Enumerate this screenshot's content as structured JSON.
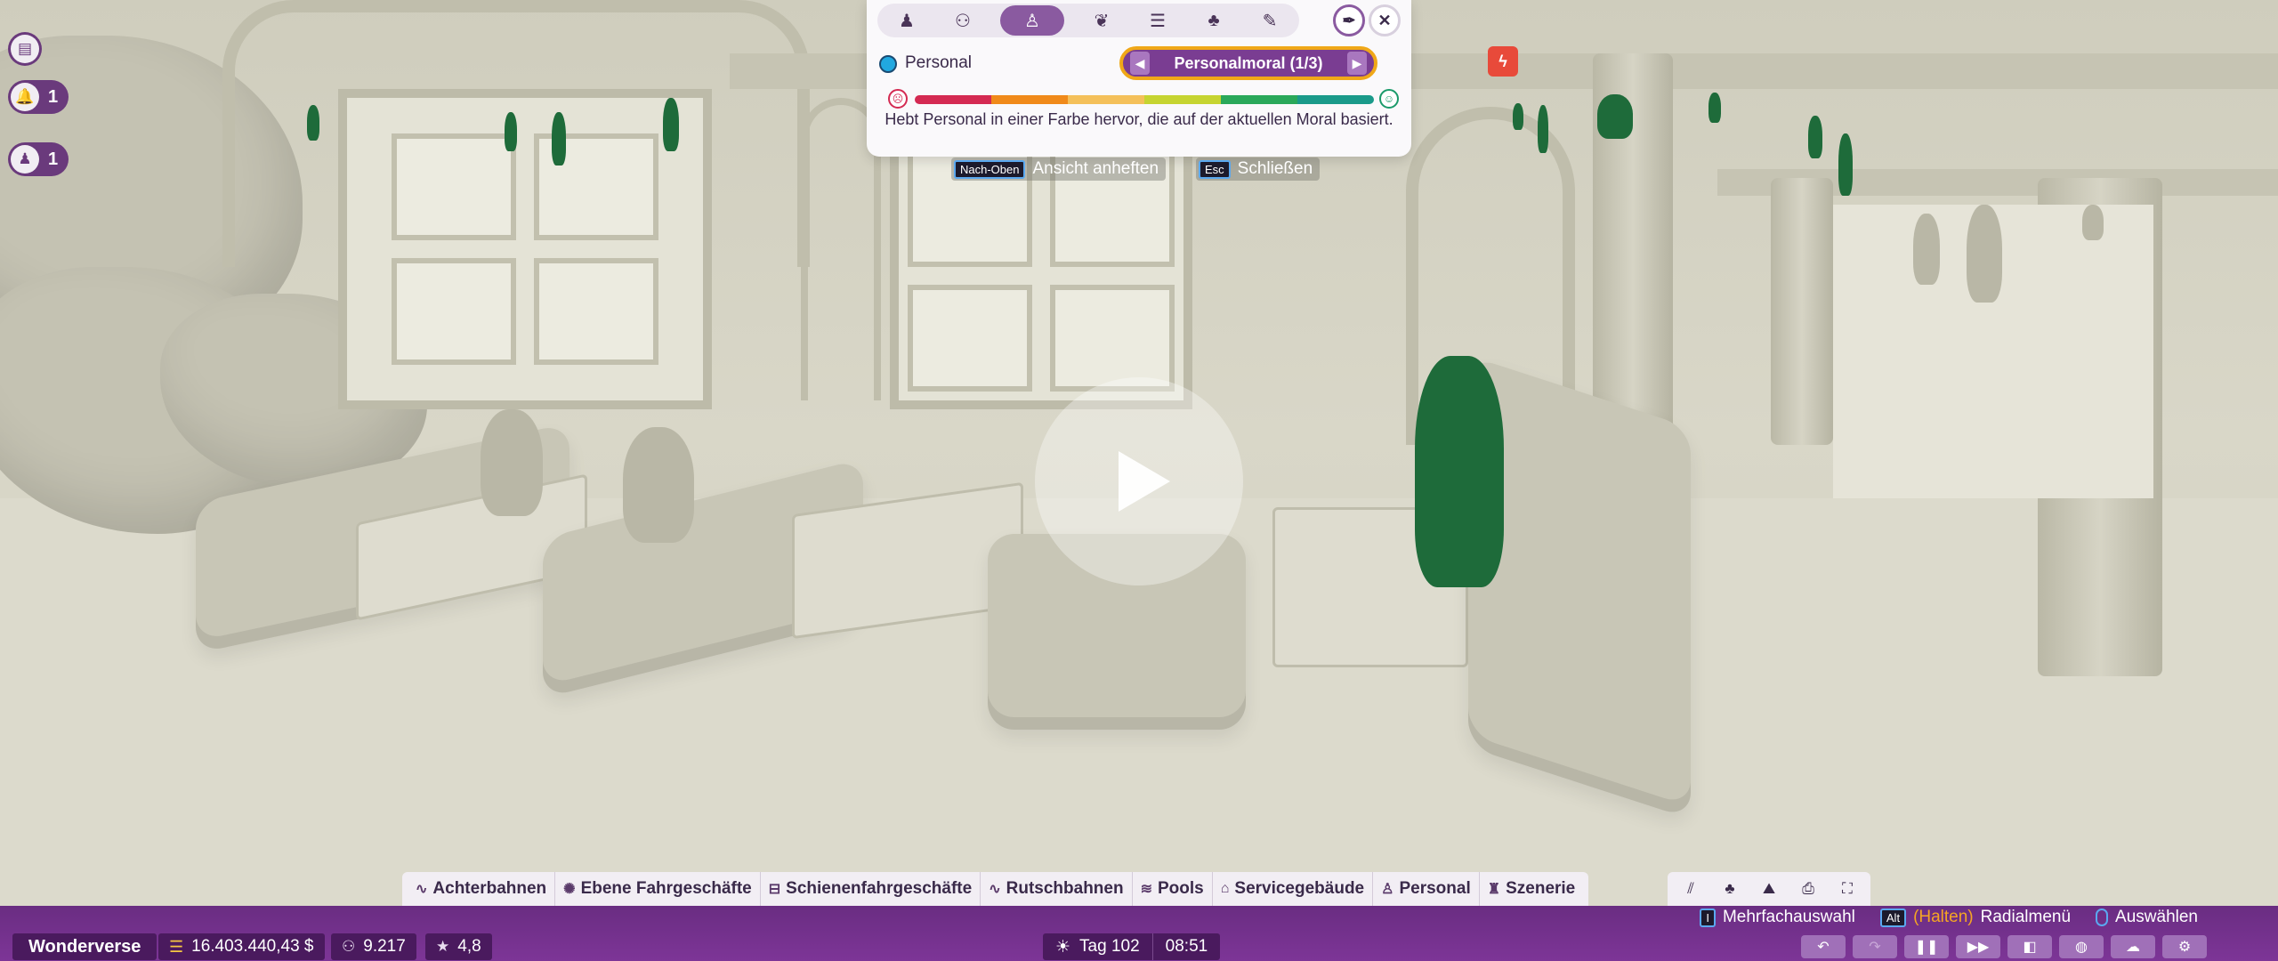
{
  "window": {
    "title": "Wonderverse"
  },
  "side_icons": [
    {
      "name": "clipboard-icon",
      "count": ""
    },
    {
      "name": "bell-icon",
      "count": "1"
    },
    {
      "name": "staff-icon",
      "count": "1"
    }
  ],
  "overlay_panel": {
    "tabs": [
      {
        "icon": "guest-star-icon",
        "active": false
      },
      {
        "icon": "guests-group-icon",
        "active": false
      },
      {
        "icon": "staff-icon",
        "active": true
      },
      {
        "icon": "drops-icon",
        "active": false
      },
      {
        "icon": "coins-icon",
        "active": false
      },
      {
        "icon": "tree-icon",
        "active": false
      },
      {
        "icon": "wrench-icon",
        "active": false
      }
    ],
    "legend_label": "Personal",
    "selector_label": "Personalmoral (1/3)",
    "description": "Hebt Personal in einer Farbe hervor, die auf der aktuellen Moral basiert.",
    "scale_colors": [
      "#d42a52",
      "#f08a1a",
      "#f4c05a",
      "#c6d431",
      "#2aa85a",
      "#1a9a8a"
    ]
  },
  "hints": {
    "pin_key": "Nach-Oben",
    "pin_label": "Ansicht anheften",
    "close_key": "Esc",
    "close_label": "Schließen"
  },
  "categories": [
    {
      "icon": "coaster-icon",
      "label": "Achterbahnen"
    },
    {
      "icon": "flat-ride-icon",
      "label": "Ebene Fahrgeschäfte"
    },
    {
      "icon": "track-ride-icon",
      "label": "Schienenfahrgeschäfte"
    },
    {
      "icon": "slide-icon",
      "label": "Rutschbahnen"
    },
    {
      "icon": "pool-icon",
      "label": "Pools"
    },
    {
      "icon": "shop-icon",
      "label": "Servicegebäude"
    },
    {
      "icon": "staff-icon",
      "label": "Personal"
    },
    {
      "icon": "scenery-icon",
      "label": "Szenerie"
    }
  ],
  "tools": [
    "path-icon",
    "tree-icon",
    "terrain-icon",
    "blueprint-icon",
    "expand-icon"
  ],
  "shortcuts": {
    "multi_key": "I",
    "multi_label": "Mehrfachauswahl",
    "alt_key": "Alt",
    "alt_hold": "(Halten)",
    "alt_label": "Radialmenü",
    "select_label": "Auswählen"
  },
  "status": {
    "park_name": "Wonderverse",
    "money": "16.403.440,43 $",
    "guests": "9.217",
    "rating": "4,8",
    "day": "Tag 102",
    "time": "08:51"
  }
}
